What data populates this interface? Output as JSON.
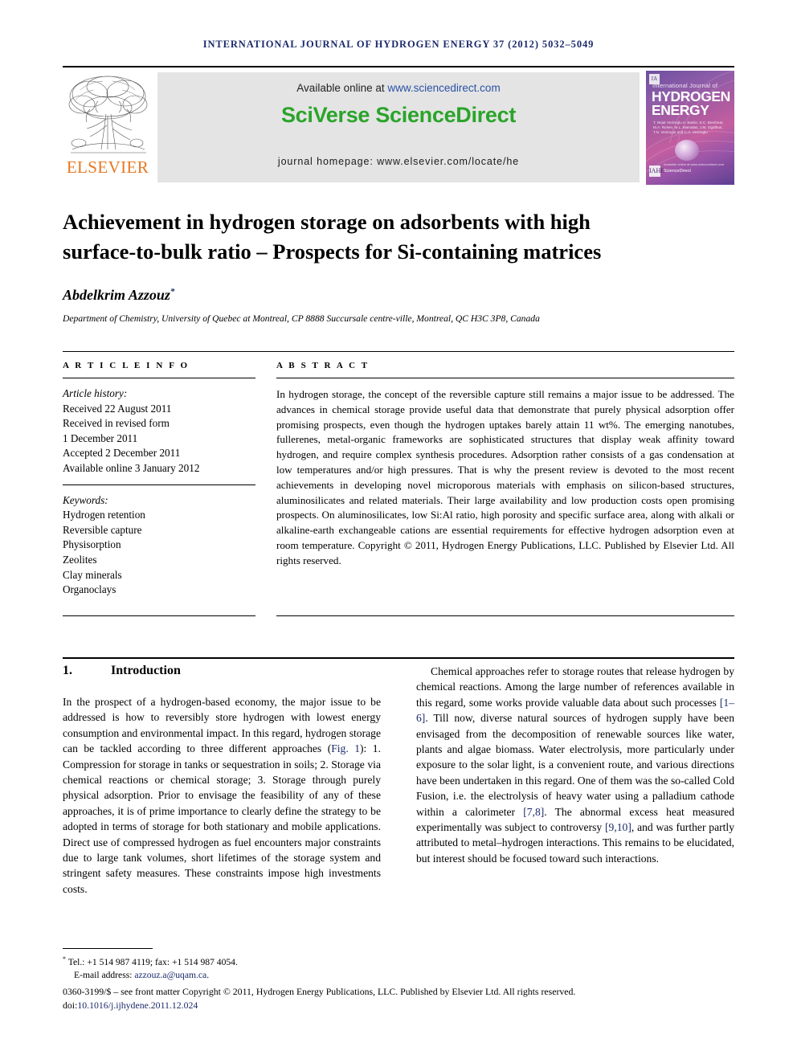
{
  "running_head": "INTERNATIONAL JOURNAL OF HYDROGEN ENERGY 37 (2012) 5032–5049",
  "masthead": {
    "publisher_name": "ELSEVIER",
    "publisher_logo_icon": "elsevier-tree-icon",
    "available_prefix": "Available online at ",
    "available_url": "www.sciencedirect.com",
    "sciverse_logo": "SciVerse ScienceDirect",
    "journal_homepage": "journal homepage: www.elsevier.com/locate/he",
    "cover": {
      "line_small": "International Journal of",
      "line_1": "HYDROGEN",
      "line_2": "ENERGY",
      "editors": "T. Nejat Veziroglu\nA. Basile, D.C. Bershear, M.A. Rosen,\nM.L. Mamalas, J.M. Ogdthus,\nT.N. Veziroglu and C.A. Veziroglu",
      "badge_tl": "IA",
      "badge_bl": "IAHE",
      "sd_mark_small": "Available online at www.sciencedirect.com",
      "sd_mark": "ScienceDirect"
    }
  },
  "article": {
    "title_line1": "Achievement in hydrogen storage on adsorbents with high",
    "title_line2": "surface-to-bulk ratio – Prospects for Si-containing matrices",
    "author": "Abdelkrim Azzouz",
    "author_marker": "*",
    "affiliation": "Department of Chemistry, University of Quebec at Montreal, CP 8888 Succursale centre-ville, Montreal, QC H3C 3P8, Canada"
  },
  "article_info": {
    "heading": "A R T I C L E   I N F O",
    "history_label": "Article history:",
    "history": [
      "Received 22 August 2011",
      "Received in revised form",
      "1 December 2011",
      "Accepted 2 December 2011",
      "Available online 3 January 2012"
    ],
    "keywords_label": "Keywords:",
    "keywords": [
      "Hydrogen retention",
      "Reversible capture",
      "Physisorption",
      "Zeolites",
      "Clay minerals",
      "Organoclays"
    ]
  },
  "abstract": {
    "heading": "A B S T R A C T",
    "text": "In hydrogen storage, the concept of the reversible capture still remains a major issue to be addressed. The advances in chemical storage provide useful data that demonstrate that purely physical adsorption offer promising prospects, even though the hydrogen uptakes barely attain 11 wt%. The emerging nanotubes, fullerenes, metal-organic frameworks are sophisticated structures that display weak affinity toward hydrogen, and require complex synthesis procedures. Adsorption rather consists of a gas condensation at low temperatures and/or high pressures. That is why the present review is devoted to the most recent achievements in developing novel microporous materials with emphasis on silicon-based structures, aluminosilicates and related materials. Their large availability and low production costs open promising prospects. On aluminosilicates, low Si:Al ratio, high porosity and specific surface area, along with alkali or alkaline-earth exchangeable cations are essential requirements for effective hydrogen adsorption even at room temperature. Copyright © 2011, Hydrogen Energy Publications, LLC. Published by Elsevier Ltd. All rights reserved."
  },
  "body": {
    "section_number": "1.",
    "section_title": "Introduction",
    "left_paragraph_parts": [
      "In the prospect of a hydrogen-based economy, the major issue to be addressed is how to reversibly store hydrogen with lowest energy consumption and environmental impact. In this regard, hydrogen storage can be tackled according to three different approaches (",
      "Fig. 1",
      "): 1. Compression for storage in tanks or sequestration in soils; 2. Storage via chemical reactions or chemical storage; 3. Storage through purely physical adsorption. Prior to envisage the feasibility of any of these approaches, it is of prime importance to clearly define the strategy to be adopted in terms of storage for both stationary and mobile applications. Direct use of compressed hydrogen as fuel encounters major constraints due to large tank volumes, short lifetimes of the storage system and stringent safety measures. These constraints impose high investments costs."
    ],
    "right_paragraph_parts": [
      "Chemical approaches refer to storage routes that release hydrogen by chemical reactions. Among the large number of references available in this regard, some works provide valuable data about such processes ",
      "[1–6]",
      ". Till now, diverse natural sources of hydrogen supply have been envisaged from the decomposition of renewable sources like water, plants and algae biomass. Water electrolysis, more particularly under exposure to the solar light, is a convenient route, and various directions have been undertaken in this regard. One of them was the so-called Cold Fusion, i.e. the electrolysis of heavy water using a palladium cathode within a calorimeter ",
      "[7,8]",
      ". The abnormal excess heat measured experimentally was subject to controversy ",
      "[9,10]",
      ", and was further partly attributed to metal–hydrogen interactions. This remains to be elucidated, but interest should be focused toward such interactions."
    ]
  },
  "footer": {
    "tel_line": "Tel.: +1 514 987 4119; fax: +1 514 987 4054.",
    "email_label": "E-mail address: ",
    "email": "azzouz.a@uqam.ca",
    "email_period": ".",
    "imprint": "0360-3199/$ – see front matter Copyright © 2011, Hydrogen Energy Publications, LLC. Published by Elsevier Ltd. All rights reserved.",
    "doi_label": "doi:",
    "doi": "10.1016/j.ijhydene.2011.12.024"
  }
}
